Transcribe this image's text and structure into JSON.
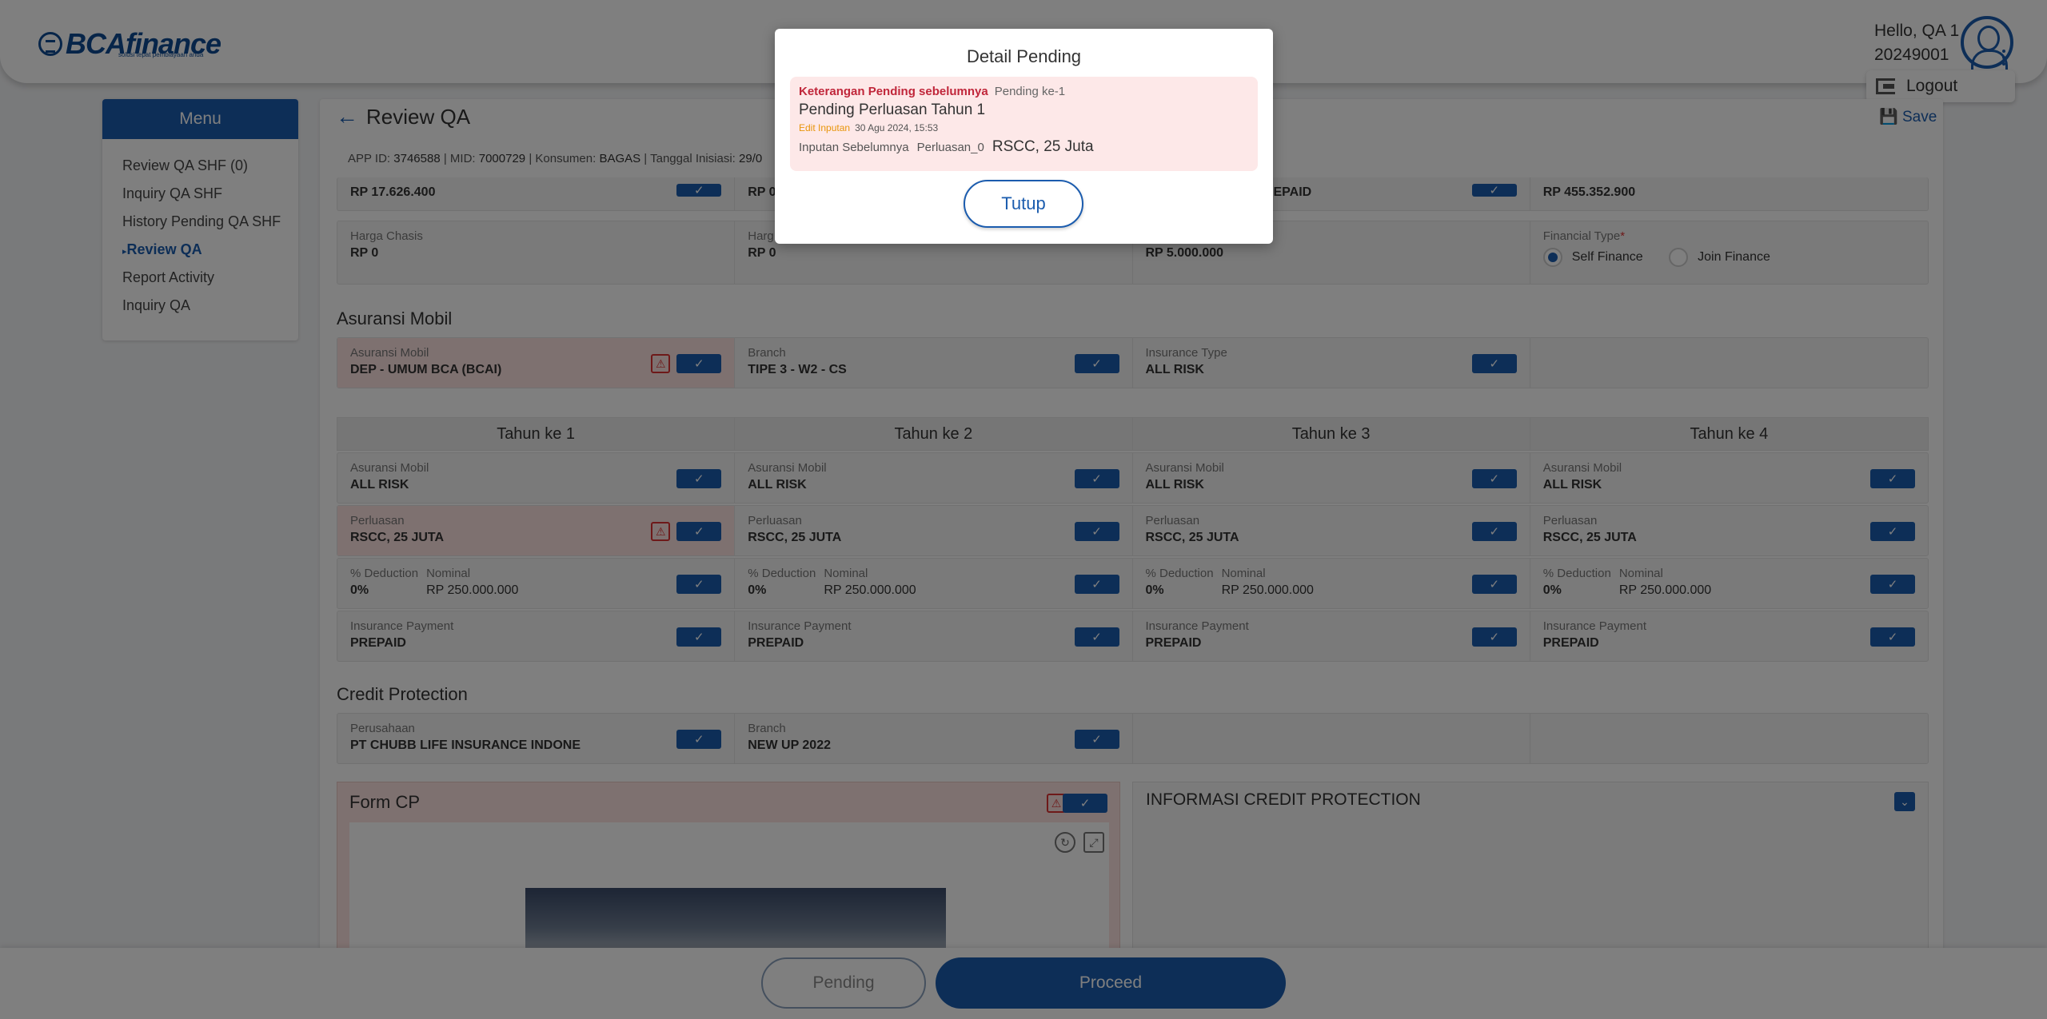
{
  "brand": {
    "name": "BCAfinance",
    "tagline": "solusi tepat pembiayaan anda"
  },
  "user": {
    "greeting": "Hello, QA 1",
    "id": "20249001",
    "logout_label": "Logout"
  },
  "menu": {
    "header": "Menu",
    "items": [
      {
        "label": "Review QA SHF (0)"
      },
      {
        "label": "Inquiry QA SHF"
      },
      {
        "label": "History Pending QA SHF"
      },
      {
        "label": "Review QA"
      },
      {
        "label": "Report Activity"
      },
      {
        "label": "Inquiry QA"
      }
    ]
  },
  "page": {
    "title": "Review QA",
    "save_label": "Save",
    "app_id_label": "APP ID:",
    "app_id": "3746588",
    "mid_label": "MID:",
    "mid": "7000729",
    "konsumen_label": "Konsumen:",
    "konsumen": "BAGAS",
    "tanggal_label": "Tanggal Inisiasi:",
    "tanggal": "29/0"
  },
  "top_rows": {
    "row1": [
      "RP 17.626.400",
      "RP 0",
      "EPAID",
      "RP 455.352.900"
    ],
    "harga_chasis_label": "Harga Chasis",
    "harga_chasis": "RP 0",
    "harga_label": "Harg",
    "harga_val": "RP 0",
    "col3_val": "RP 5.000.000",
    "financial_type_label": "Financial Type",
    "financial_required": "*",
    "self_finance": "Self Finance",
    "join_finance": "Join Finance"
  },
  "asuransi_mobil": {
    "title": "Asuransi Mobil",
    "cells": [
      {
        "label": "Asuransi Mobil",
        "value": "DEP - UMUM BCA (BCAI)"
      },
      {
        "label": "Branch",
        "value": "TIPE 3 - W2 - CS"
      },
      {
        "label": "Insurance Type",
        "value": "ALL RISK"
      }
    ]
  },
  "years": {
    "headers": [
      "Tahun ke 1",
      "Tahun ke 2",
      "Tahun ke 3",
      "Tahun ke 4"
    ],
    "asuransi_label": "Asuransi Mobil",
    "asuransi_value": "ALL RISK",
    "perluasan_label": "Perluasan",
    "perluasan_value": "RSCC, 25 JUTA",
    "deduction_label": "% Deduction",
    "deduction_value": "0%",
    "nominal_label": "Nominal",
    "nominal_value": "RP 250.000.000",
    "payment_label": "Insurance Payment",
    "payment_value": "PREPAID"
  },
  "credit_protection": {
    "title": "Credit Protection",
    "perusahaan_label": "Perusahaan",
    "perusahaan_value": "PT CHUBB LIFE INSURANCE INDONE",
    "branch_label": "Branch",
    "branch_value": "NEW UP 2022",
    "form_cp_title": "Form CP",
    "info_title": "INFORMASI CREDIT PROTECTION"
  },
  "bottom": {
    "pending_label": "Pending",
    "proceed_label": "Proceed"
  },
  "modal": {
    "title": "Detail Pending",
    "keterangan": "Keterangan Pending sebelumnya",
    "pending_ke": "Pending ke-1",
    "reason": "Pending Perluasan Tahun 1",
    "edit_label": "Edit Inputan",
    "edit_time": "30 Agu 2024, 15:53",
    "prev_label": "Inputan Sebelumnya",
    "prev_field": "Perluasan_0",
    "prev_value": "RSCC, 25 Juta",
    "close_label": "Tutup"
  },
  "colors": {
    "primary": "#1b5cae",
    "pending_bg": "#fde2e0",
    "alert_red": "#c0263a",
    "edit_orange": "#e8950a"
  }
}
